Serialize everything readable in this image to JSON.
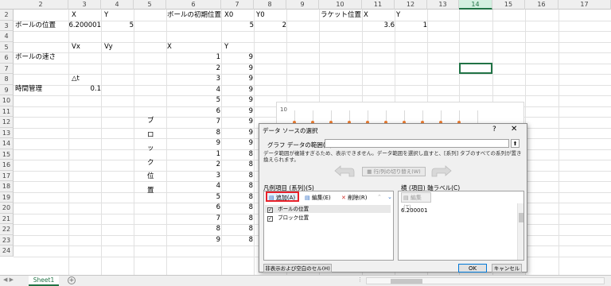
{
  "sheet": {
    "columns": [
      "2",
      "3",
      "4",
      "5",
      "6",
      "7",
      "8",
      "9",
      "10",
      "11",
      "12",
      "13",
      "14",
      "15",
      "16",
      "17"
    ],
    "active_column": "14",
    "rows": [
      "2",
      "3",
      "4",
      "5",
      "6",
      "7",
      "8",
      "9",
      "10",
      "11",
      "12",
      "13",
      "14",
      "15",
      "16",
      "17",
      "18",
      "19",
      "20",
      "21",
      "22",
      "23",
      "24"
    ],
    "cells": {
      "x_hdr": "X",
      "y_hdr": "Y",
      "ball_pos_label": "ボールの位置",
      "ball_x": "6.200001",
      "ball_y": "5",
      "init_pos_label": "ボールの初期位置",
      "x0_hdr": "X0",
      "y0_hdr": "Y0",
      "x0_val": "5",
      "y0_val": "2",
      "racket_label": "ラケット位置",
      "racket_x_hdr": "X",
      "racket_y_hdr": "Y",
      "racket_x": "3.6",
      "racket_y": "1",
      "vx_hdr": "Vx",
      "vy_hdr": "Vy",
      "block_x_hdr": "X",
      "block_y_hdr": "Y",
      "ball_speed_label": "ボールの速さ",
      "dt_label": "△t",
      "time_label": "時間管理",
      "dt_val": "0.1",
      "block_label_chars": [
        "ブ",
        "ロ",
        "ッ",
        "ク",
        "位",
        "置"
      ],
      "block_x_values": [
        "1",
        "2",
        "3",
        "4",
        "5",
        "6",
        "7",
        "8",
        "9",
        "1",
        "2",
        "3",
        "4",
        "5",
        "6",
        "7",
        "8",
        "9"
      ],
      "block_y_values": [
        "9",
        "9",
        "9",
        "9",
        "9",
        "9",
        "9",
        "9",
        "9",
        "8",
        "8",
        "8",
        "8",
        "8",
        "8",
        "8",
        "8",
        "8"
      ]
    }
  },
  "chart": {
    "y_tick": "10"
  },
  "dialog": {
    "title": "データ ソースの選択",
    "help": "?",
    "close": "✕",
    "range_label": "グラフ データの範囲(D):",
    "range_value": "",
    "warning": "データ範囲が複雑すぎるため、表示できません。データ範囲を選択し直すと、[系列] タブのすべての系列が置き換えられます。",
    "switch_label": "行/列の切り替え(W)",
    "legend_label": "凡例項目 (系列)(S)",
    "axis_label": "横 (項目) 軸ラベル(C)",
    "add_label": "追加(A)",
    "edit_label": "編集(E)",
    "delete_label": "削除(R)",
    "axis_edit_label": "編集(T)",
    "series": [
      {
        "name": "ボールの位置",
        "checked": true,
        "selected": true
      },
      {
        "name": "ブロック位置",
        "checked": true,
        "selected": false
      }
    ],
    "axis_items": [
      "6.200001"
    ],
    "hidden_cells_label": "非表示および空白のセル(H)",
    "ok_label": "OK",
    "cancel_label": "キャンセル"
  },
  "footer": {
    "sheet_tab": "Sheet1",
    "add_sheet": "+",
    "dots": "⋮"
  }
}
